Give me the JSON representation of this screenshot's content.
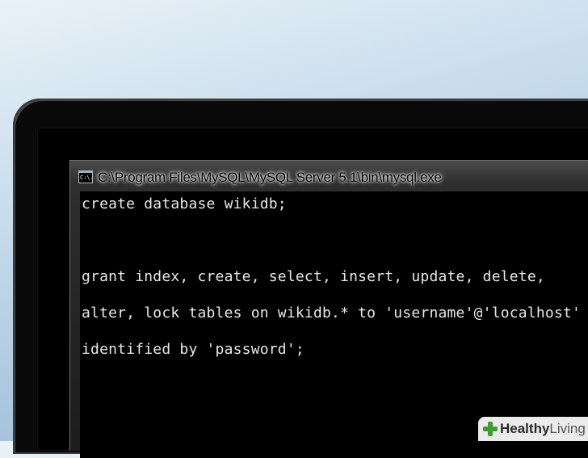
{
  "window": {
    "title": "C:\\Program Files\\MySQL\\MySQL Server 5.1\\bin\\mysql.exe",
    "icon": "cmd-icon",
    "icon_label": "C:\\."
  },
  "console": {
    "lines": [
      "create database wikidb;",
      "",
      "grant index, create, select, insert, update, delete,",
      "alter, lock tables on wikidb.* to 'username'@'localhost'",
      "identified by 'password';"
    ]
  },
  "watermark": {
    "brand_bold": "Healthy",
    "brand_light": "Living"
  },
  "colors": {
    "console_bg": "#000000",
    "console_text": "#e8e8e8",
    "wall_gradient_top": "#e9f2f8",
    "wall_gradient_bottom": "#97b8d2",
    "brand_green": "#3f9c35"
  }
}
